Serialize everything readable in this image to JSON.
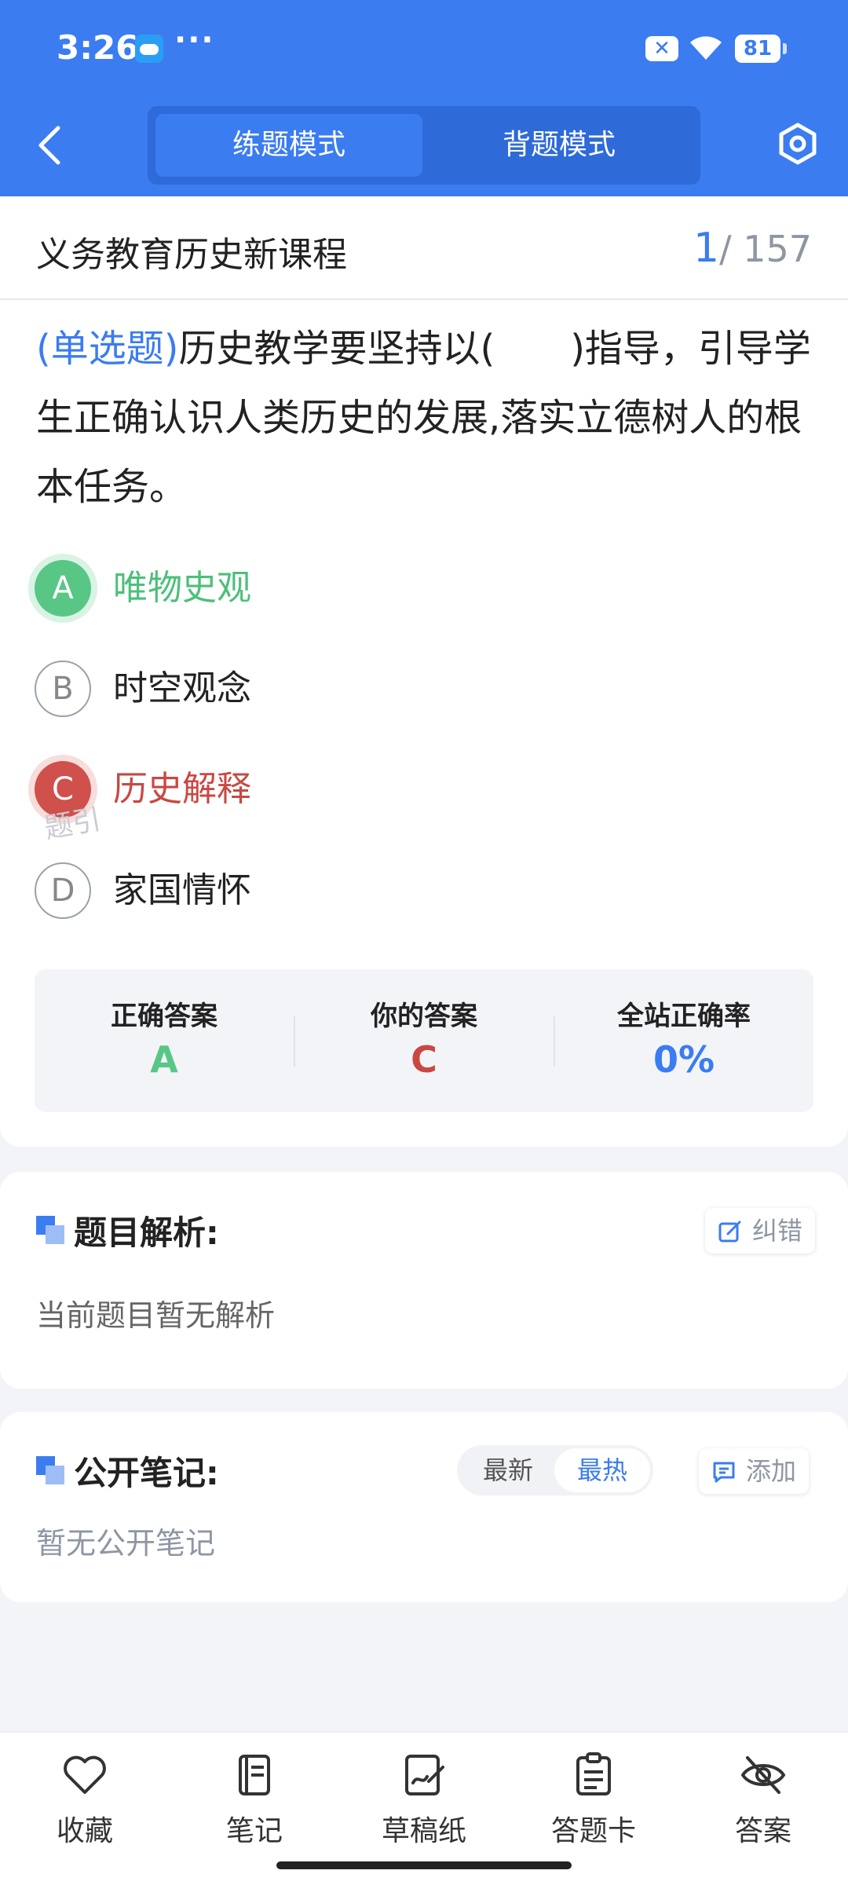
{
  "status_bar": {
    "time": "3:26",
    "dots": "···",
    "battery": "81"
  },
  "header": {
    "mode_practice": "练题模式",
    "mode_memorize": "背题模式"
  },
  "question_card": {
    "course_title": "义务教育历史新课程",
    "counter_current": "1",
    "counter_total": "/ 157",
    "question_type": "(单选题)",
    "question_text": "历史教学要坚持以(　　)指导，引导学生正确认识人类历史的发展,落实立德树人的根本任务。",
    "options": [
      {
        "letter": "A",
        "text": "唯物史观",
        "state": "correct"
      },
      {
        "letter": "B",
        "text": "时空观念",
        "state": "normal"
      },
      {
        "letter": "C",
        "text": "历史解释",
        "state": "wrong"
      },
      {
        "letter": "D",
        "text": "家国情怀",
        "state": "normal"
      }
    ],
    "answers": {
      "correct_label": "正确答案",
      "correct_value": "A",
      "yours_label": "你的答案",
      "yours_value": "C",
      "rate_label": "全站正确率",
      "rate_value": "0%"
    },
    "watermark": "题引"
  },
  "analysis": {
    "title": "题目解析:",
    "correct_button": "纠错",
    "body": "当前题目暂无解析"
  },
  "notes": {
    "title": "公开笔记:",
    "sort_latest": "最新",
    "sort_hot": "最热",
    "add_button": "添加",
    "body": "暂无公开笔记"
  },
  "bottom_nav": [
    {
      "label": "收藏",
      "icon": "heart-icon"
    },
    {
      "label": "笔记",
      "icon": "notebook-icon"
    },
    {
      "label": "草稿纸",
      "icon": "draft-icon"
    },
    {
      "label": "答题卡",
      "icon": "answer-card-icon"
    },
    {
      "label": "答案",
      "icon": "eye-off-icon"
    }
  ],
  "colors": {
    "primary": "#3b7cf1",
    "correct": "#58c785",
    "wrong": "#d0504c"
  }
}
